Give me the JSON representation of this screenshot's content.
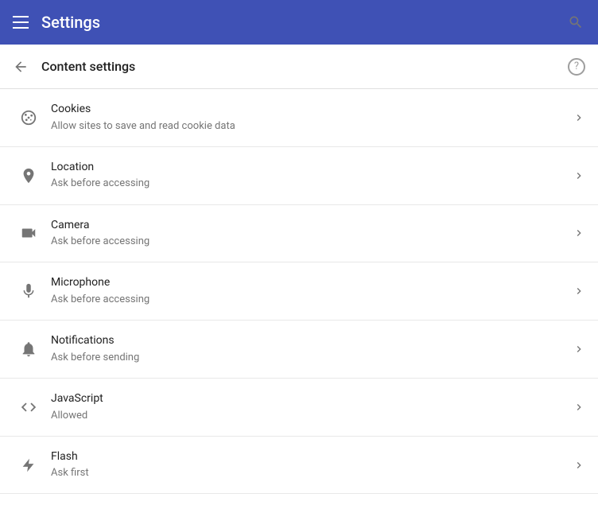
{
  "header": {
    "title": "Settings",
    "hamburger_label": "menu",
    "search_label": "search"
  },
  "subheader": {
    "title": "Content settings",
    "back_label": "back",
    "help_label": "?"
  },
  "items": [
    {
      "id": "cookies",
      "title": "Cookies",
      "subtitle": "Allow sites to save and read cookie data",
      "icon": "cookies"
    },
    {
      "id": "location",
      "title": "Location",
      "subtitle": "Ask before accessing",
      "icon": "location"
    },
    {
      "id": "camera",
      "title": "Camera",
      "subtitle": "Ask before accessing",
      "icon": "camera"
    },
    {
      "id": "microphone",
      "title": "Microphone",
      "subtitle": "Ask before accessing",
      "icon": "microphone"
    },
    {
      "id": "notifications",
      "title": "Notifications",
      "subtitle": "Ask before sending",
      "icon": "notifications"
    },
    {
      "id": "javascript",
      "title": "JavaScript",
      "subtitle": "Allowed",
      "icon": "javascript"
    },
    {
      "id": "flash",
      "title": "Flash",
      "subtitle": "Ask first",
      "icon": "flash"
    }
  ]
}
